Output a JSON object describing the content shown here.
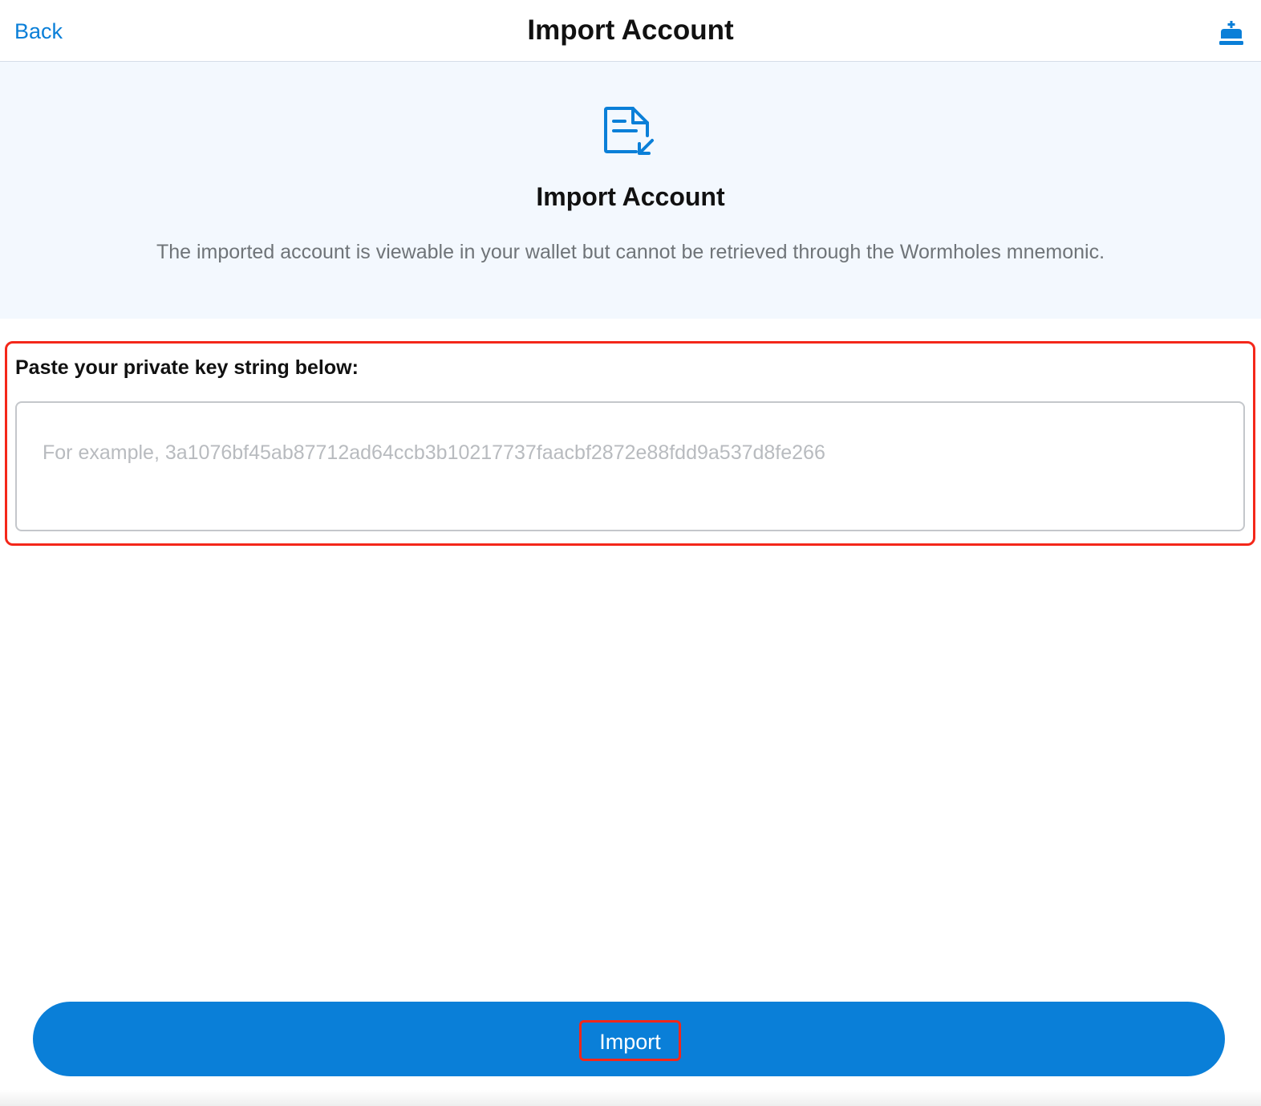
{
  "header": {
    "back_label": "Back",
    "title": "Import Account",
    "right_icon": "account-add-icon"
  },
  "hero": {
    "icon": "document-import-icon",
    "title": "Import Account",
    "description": "The imported account is viewable in your wallet but cannot be retrieved through the Wormholes mnemonic."
  },
  "key_form": {
    "label": "Paste your private key string below:",
    "placeholder": "For example, 3a1076bf45ab87712ad64ccb3b10217737faacbf2872e88fdd9a537d8fe266",
    "value": ""
  },
  "footer": {
    "import_label": "Import"
  },
  "colors": {
    "accent": "#0a7fd8",
    "highlight": "#f4271a",
    "hero_bg": "#f3f8fe"
  }
}
